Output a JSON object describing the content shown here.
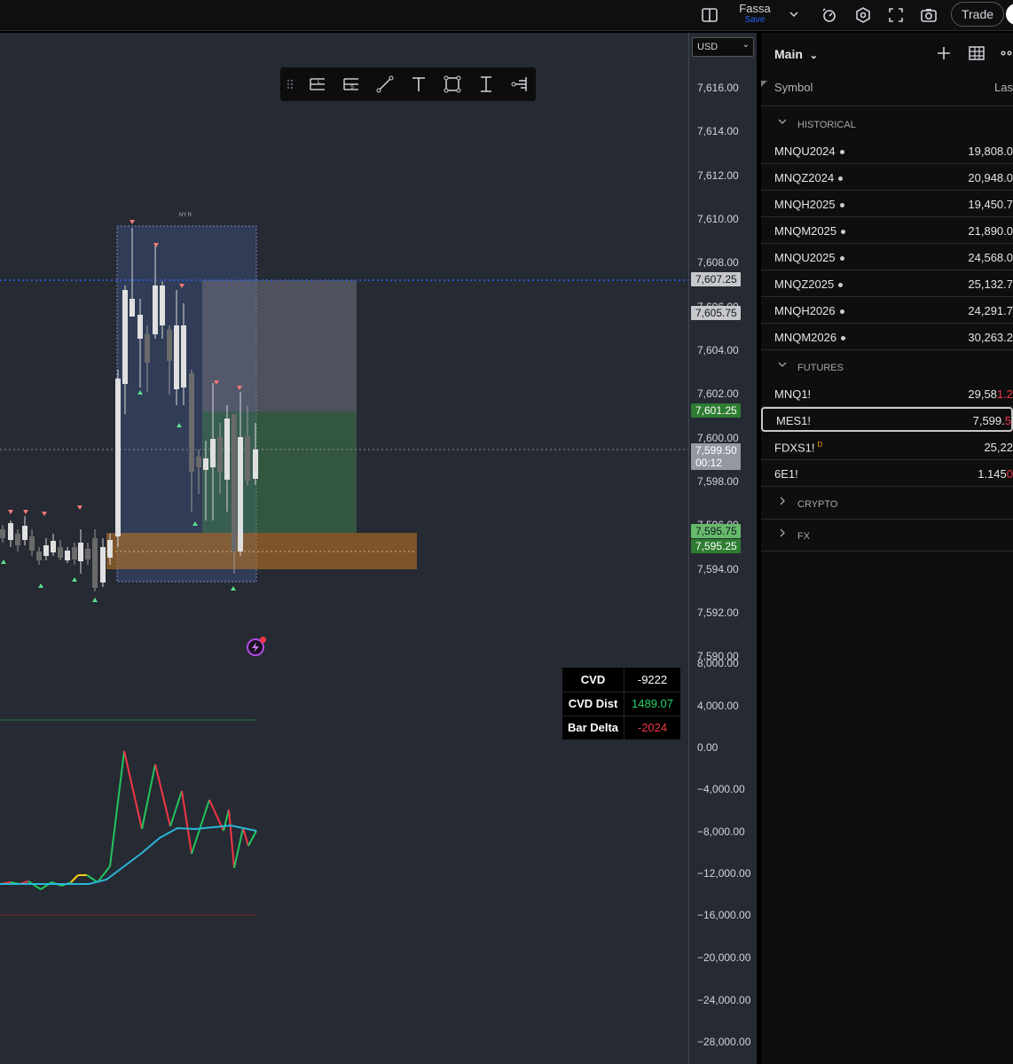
{
  "topbar": {
    "layout_label": "Fassa",
    "save_label": "Save",
    "trade_label": "Trade",
    "icons": [
      "panels-icon",
      "chevron-down-icon",
      "alert-icon",
      "settings-icon",
      "fullscreen-icon",
      "camera-icon"
    ]
  },
  "drawing_toolbar": {
    "tools": [
      "drag-handle-icon",
      "long-position-icon",
      "short-position-icon",
      "trendline-icon",
      "text-icon",
      "rectangle-icon",
      "measure-icon",
      "volume-profile-icon"
    ]
  },
  "chart": {
    "session_label": "NY R",
    "currency": "USD",
    "price_labels": [
      "7,616.00",
      "7,614.00",
      "7,612.00",
      "7,610.00",
      "7,608.00",
      "7,606.00",
      "7,604.00",
      "7,602.00",
      "7,600.00",
      "7,598.00",
      "7,596.00",
      "7,594.00",
      "7,592.00",
      "7,590.00"
    ],
    "price_tags": {
      "tag_7607": "7,607.25",
      "tag_7605": "7,605.75",
      "tag_7601": "7,601.25",
      "tag_last": "7,599.50",
      "countdown": "00:12",
      "tag_7595a": "7,595.75",
      "tag_7595b": "7,595.25"
    },
    "indicator_labels": [
      "8,000.00",
      "4,000.00",
      "0.00",
      "−4,000.00",
      "−8,000.00",
      "−12,000.00",
      "−16,000.00",
      "−20,000.00",
      "−24,000.00",
      "−28,000.00"
    ]
  },
  "cvd_table": {
    "rows": [
      {
        "key": "CVD",
        "value": "-9222",
        "color": "#ffffff"
      },
      {
        "key": "CVD Dist",
        "value": "1489.07",
        "color": "#22d36b"
      },
      {
        "key": "Bar Delta",
        "value": "-2024",
        "color": "#f23645"
      }
    ]
  },
  "watchlist": {
    "title": "Main",
    "col_symbol": "Symbol",
    "col_last": "Las",
    "sections": [
      {
        "name": "HISTORICAL",
        "expanded": true,
        "rows": [
          {
            "sym": "MNQU2024",
            "last": "19,808.0",
            "dot": true
          },
          {
            "sym": "MNQZ2024",
            "last": "20,948.0",
            "dot": true
          },
          {
            "sym": "MNQH2025",
            "last": "19,450.7",
            "dot": true
          },
          {
            "sym": "MNQM2025",
            "last": "21,890.0",
            "dot": true
          },
          {
            "sym": "MNQU2025",
            "last": "24,568.0",
            "dot": true
          },
          {
            "sym": "MNQZ2025",
            "last": "25,132.7",
            "dot": true
          },
          {
            "sym": "MNQH2026",
            "last": "24,291.7",
            "dot": true
          },
          {
            "sym": "MNQM2026",
            "last": "30,263.2",
            "dot": true
          }
        ]
      },
      {
        "name": "FUTURES",
        "expanded": true,
        "rows": [
          {
            "sym": "MNQ1!",
            "last": "29,58",
            "last_red": "1.2"
          },
          {
            "sym": "MES1!",
            "last": "7,599.",
            "last_red": "5",
            "selected": true
          },
          {
            "sym": "FDXS1!",
            "sup": "D",
            "last": "25,22"
          },
          {
            "sym": "6E1!",
            "last": "1.145",
            "last_red": "0"
          }
        ]
      },
      {
        "name": "CRYPTO",
        "expanded": false
      },
      {
        "name": "FX",
        "expanded": false
      }
    ]
  }
}
